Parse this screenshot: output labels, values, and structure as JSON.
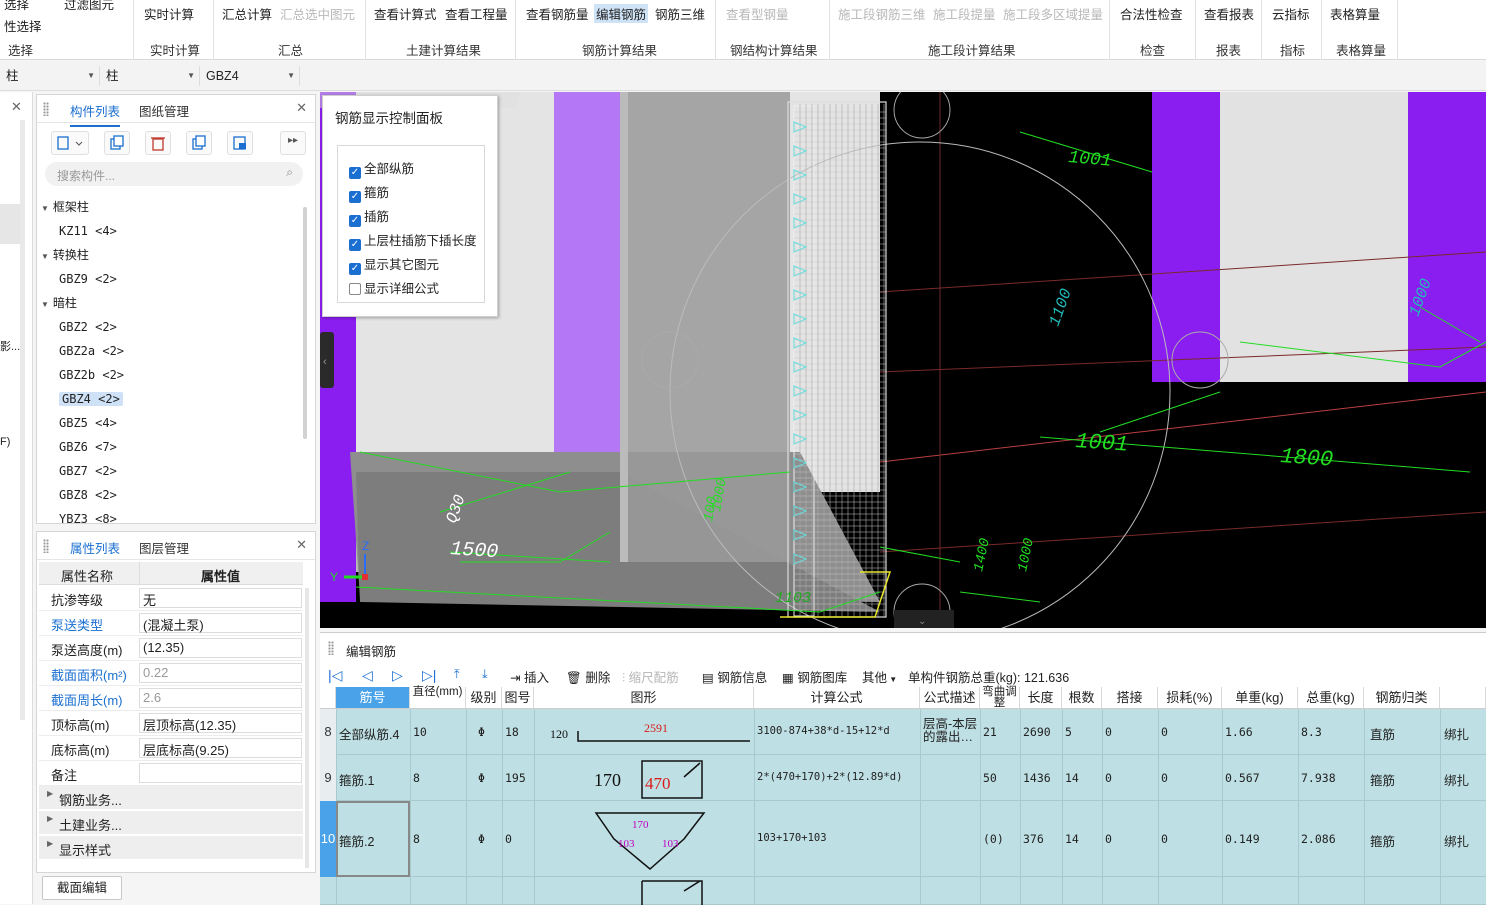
{
  "ribbon": {
    "select_group": {
      "btn1": "选择",
      "btn2": "性选择",
      "btn3": "过滤图元",
      "label": "选择"
    },
    "realtime": {
      "btn": "实时计算",
      "label": "实时计算"
    },
    "summary": {
      "btn1": "汇总计算",
      "btn2": "汇总选中图元",
      "label": "汇总"
    },
    "civil": {
      "btn1": "查看计算式",
      "btn2": "查看工程量",
      "label": "土建计算结果"
    },
    "rebar": {
      "btn1": "查看钢筋量",
      "btn2": "编辑钢筋",
      "btn3": "钢筋三维",
      "label": "钢筋计算结果"
    },
    "steel": {
      "btn1": "查看型钢量",
      "label": "钢结构计算结果"
    },
    "segment": {
      "btn1": "施工段钢筋三维",
      "btn2": "施工段提量",
      "btn3": "施工段多区域提量",
      "label": "施工段计算结果"
    },
    "check": {
      "btn": "合法性检查",
      "label": "检查"
    },
    "report": {
      "btn": "查看报表",
      "label": "报表"
    },
    "index": {
      "btn": "云指标",
      "label": "指标"
    },
    "table": {
      "btn": "表格算量",
      "label": "表格算量"
    }
  },
  "combos": {
    "c1": "柱",
    "c2": "柱",
    "c3": "GBZ4"
  },
  "left_stub": {
    "t1": "影...",
    "t2": "F)"
  },
  "component_panel": {
    "tab_active": "构件列表",
    "tab_other": "图纸管理",
    "search_placeholder": "搜索构件...",
    "tree": [
      {
        "label": "框架柱",
        "type": "group"
      },
      {
        "label": "KZ11 <4>",
        "type": "item"
      },
      {
        "label": "转换柱",
        "type": "group"
      },
      {
        "label": "GBZ9 <2>",
        "type": "item"
      },
      {
        "label": "暗柱",
        "type": "group"
      },
      {
        "label": "GBZ2 <2>",
        "type": "item"
      },
      {
        "label": "GBZ2a <2>",
        "type": "item"
      },
      {
        "label": "GBZ2b <2>",
        "type": "item"
      },
      {
        "label": "GBZ4 <2>",
        "type": "item",
        "selected": true
      },
      {
        "label": "GBZ5 <4>",
        "type": "item"
      },
      {
        "label": "GBZ6 <7>",
        "type": "item"
      },
      {
        "label": "GBZ7 <2>",
        "type": "item"
      },
      {
        "label": "GBZ8 <2>",
        "type": "item"
      },
      {
        "label": "YBZ3 <8>",
        "type": "item"
      }
    ]
  },
  "property_panel": {
    "tab_active": "属性列表",
    "tab_other": "图层管理",
    "header_name": "属性名称",
    "header_value": "属性值",
    "rows": [
      {
        "name": "抗渗等级",
        "value": "无",
        "blue": false,
        "disabled": false
      },
      {
        "name": "泵送类型",
        "value": "(混凝土泵)",
        "blue": true,
        "disabled": false
      },
      {
        "name": "泵送高度(m)",
        "value": "(12.35)",
        "blue": false,
        "disabled": false
      },
      {
        "name": "截面面积(m²)",
        "value": "0.22",
        "blue": true,
        "disabled": true
      },
      {
        "name": "截面周长(m)",
        "value": "2.6",
        "blue": true,
        "disabled": true
      },
      {
        "name": "顶标高(m)",
        "value": "层顶标高(12.35)",
        "blue": false,
        "disabled": false
      },
      {
        "name": "底标高(m)",
        "value": "层底标高(9.25)",
        "blue": false,
        "disabled": false
      },
      {
        "name": "备注",
        "value": "",
        "blue": false,
        "disabled": false
      }
    ],
    "groups": [
      "钢筋业务...",
      "土建业务...",
      "显示样式"
    ],
    "footer_button": "截面编辑"
  },
  "rebar_panel": {
    "title": "钢筋显示控制面板",
    "options": [
      {
        "label": "全部纵筋",
        "checked": true
      },
      {
        "label": "箍筋",
        "checked": true
      },
      {
        "label": "插筋",
        "checked": true
      },
      {
        "label": "上层柱插筋下插长度",
        "checked": true
      },
      {
        "label": "显示其它图元",
        "checked": true
      },
      {
        "label": "显示详细公式",
        "checked": false
      }
    ]
  },
  "viewport": {
    "dims": [
      "1500",
      "Q30",
      "1103",
      "1800",
      "1001",
      "1001",
      "1000",
      "100",
      "1000",
      "1100",
      "1400",
      "1000"
    ],
    "axis_z": "Z",
    "axis_y": "Y"
  },
  "editor": {
    "title": "编辑钢筋",
    "tools": {
      "insert": "插入",
      "delete": "删除",
      "scale": "缩尺配筋",
      "info": "钢筋信息",
      "library": "钢筋图库",
      "other": "其他",
      "total": "单构件钢筋总重(kg): 121.636"
    },
    "headers": [
      "筋号",
      "直径(mm)",
      "级别",
      "图号",
      "图形",
      "计算公式",
      "公式描述",
      "弯曲调整",
      "长度",
      "根数",
      "搭接",
      "损耗(%)",
      "单重(kg)",
      "总重(kg)",
      "钢筋归类",
      ""
    ],
    "rows": [
      {
        "num": "8",
        "name": "全部纵筋.4",
        "dia": "10",
        "grade": "Φ",
        "fig": "18",
        "shape_left": "120",
        "shape_mid": "2591",
        "formula": "3100-874+38*d-15+12*d",
        "desc": "层高-本层的露出…",
        "bend": "21",
        "length": "2690",
        "count": "5",
        "lap": "0",
        "loss": "0",
        "unit": "1.66",
        "total": "8.3",
        "cat": "直筋",
        "conn": "绑扎"
      },
      {
        "num": "9",
        "name": "箍筋.1",
        "dia": "8",
        "grade": "Φ",
        "fig": "195",
        "shape_left": "170",
        "shape_mid": "470",
        "formula": "2*(470+170)+2*(12.89*d)",
        "desc": "",
        "bend": "50",
        "length": "1436",
        "count": "14",
        "lap": "0",
        "loss": "0",
        "unit": "0.567",
        "total": "7.938",
        "cat": "箍筋",
        "conn": "绑扎"
      },
      {
        "num": "10",
        "name": "箍筋.2",
        "dia": "8",
        "grade": "Φ",
        "fig": "0",
        "shape_left": "103",
        "shape_mid": "170",
        "shape_right": "103",
        "formula": "103+170+103",
        "desc": "",
        "bend": "(0)",
        "length": "376",
        "count": "14",
        "lap": "0",
        "loss": "0",
        "unit": "0.149",
        "total": "2.086",
        "cat": "箍筋",
        "conn": "绑扎"
      }
    ]
  },
  "colors": {
    "accent": "#1a6fd0",
    "row_bg": "#bedfe3",
    "purple": "#8a1ef0",
    "green": "#22dd22"
  }
}
